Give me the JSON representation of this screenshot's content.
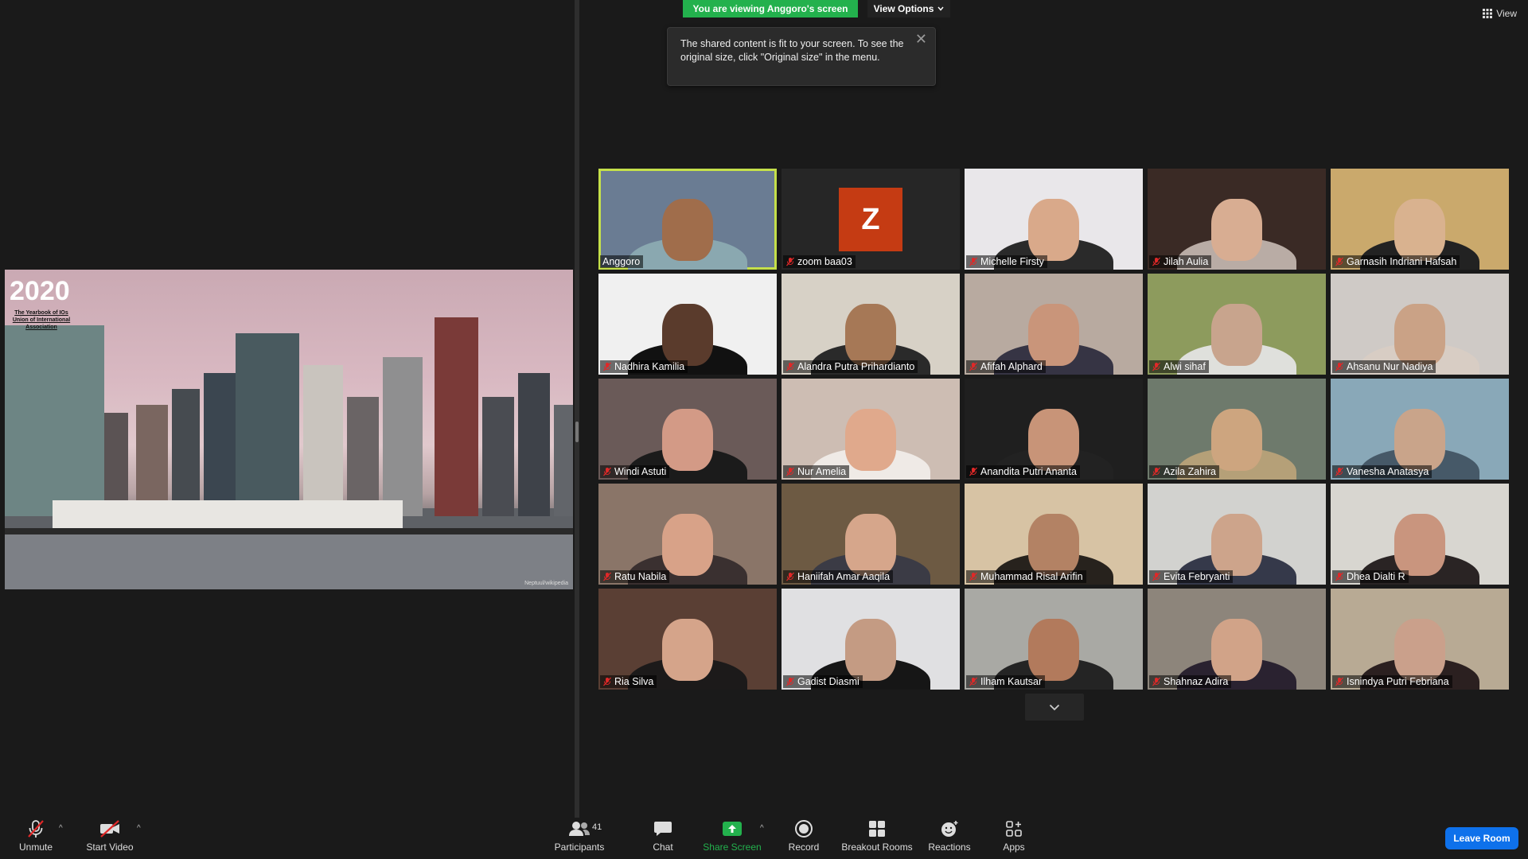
{
  "banner": {
    "viewing": "You are viewing Anggoro's screen",
    "view_options": "View Options"
  },
  "tooltip": {
    "text": "The shared content is fit to your screen. To see the original size, click \"Original size\" in the menu."
  },
  "view_button": {
    "label": "View"
  },
  "slide": {
    "year": "2020",
    "subtitle": "The Yearbook of IOs Union of International Association",
    "credit": "Neptuul/wikipedia"
  },
  "participants": [
    {
      "name": "Anggoro",
      "muted": false,
      "bg": "#6a7c93",
      "skin": "#a06d4b",
      "shirt": "#8aa8b0",
      "active": true
    },
    {
      "name": "zoom baa03",
      "muted": true,
      "avatar": "Z"
    },
    {
      "name": "Michelle Firsty",
      "muted": true,
      "bg": "#e9e7ea",
      "skin": "#d9a98a",
      "shirt": "#2a2a2a"
    },
    {
      "name": "Jilah Aulia",
      "muted": true,
      "bg": "#3a2a25",
      "skin": "#d8ad92",
      "shirt": "#b9aca5"
    },
    {
      "name": "Garnasih Indriani Hafsah",
      "muted": true,
      "bg": "#caa96c",
      "skin": "#d9b28f",
      "shirt": "#222"
    },
    {
      "name": "Nadhira Kamilia",
      "muted": true,
      "bg": "#f0f0f0",
      "skin": "#5a3b2c",
      "shirt": "#111"
    },
    {
      "name": "Alandra Putra Prihardianto",
      "muted": true,
      "bg": "#d7d1c6",
      "skin": "#a67856",
      "shirt": "#2a2a2a"
    },
    {
      "name": "Afifah Alphard",
      "muted": true,
      "bg": "#b8aaa0",
      "skin": "#c9957a",
      "shirt": "#363444"
    },
    {
      "name": "Alwi sihaf",
      "muted": true,
      "bg": "#8d9b5d",
      "skin": "#c8a48d",
      "shirt": "#dfe0dc"
    },
    {
      "name": "Ahsanu Nur Nadiya",
      "muted": true,
      "bg": "#cfcac6",
      "skin": "#caa286",
      "shirt": "#d8cdc4"
    },
    {
      "name": "Windi Astuti",
      "muted": true,
      "bg": "#6a5a58",
      "skin": "#d39a86",
      "shirt": "#1b1b1b"
    },
    {
      "name": "Nur Amelia",
      "muted": true,
      "bg": "#cdbdb3",
      "skin": "#e0a98c",
      "shirt": "#efeae6"
    },
    {
      "name": "Anandita Putri Ananta",
      "muted": true,
      "bg": "#1f1f1f",
      "skin": "#c89478",
      "shirt": "#222"
    },
    {
      "name": "Azila Zahira",
      "muted": true,
      "bg": "#6e7a6c",
      "skin": "#cda57f",
      "shirt": "#b5a078"
    },
    {
      "name": "Vanesha Anatasya",
      "muted": true,
      "bg": "#89a8b8",
      "skin": "#c9a48a",
      "shirt": "#465968"
    },
    {
      "name": "Ratu Nabila",
      "muted": true,
      "bg": "#8a7568",
      "skin": "#d8a288",
      "shirt": "#3a3030"
    },
    {
      "name": "Haniifah Amar Aaqila",
      "muted": true,
      "bg": "#6d5a43",
      "skin": "#d6a68b",
      "shirt": "#3b3b45"
    },
    {
      "name": "Muhammad Risal Arifin",
      "muted": true,
      "bg": "#d7c3a4",
      "skin": "#b38264",
      "shirt": "#27221d"
    },
    {
      "name": "Evita Febryanti",
      "muted": true,
      "bg": "#d2d2cf",
      "skin": "#cda48b",
      "shirt": "#35394a"
    },
    {
      "name": "Dhea Dialti R",
      "muted": true,
      "bg": "#d8d6d0",
      "skin": "#c9957e",
      "shirt": "#2a2424"
    },
    {
      "name": "Ria Silva",
      "muted": true,
      "bg": "#5a3f34",
      "skin": "#d5a48a",
      "shirt": "#1c1a1a"
    },
    {
      "name": "Gadist Diasmi",
      "muted": true,
      "bg": "#e0e0e2",
      "skin": "#c49b83",
      "shirt": "#161616"
    },
    {
      "name": "Ilham Kautsar",
      "muted": true,
      "bg": "#a9a9a4",
      "skin": "#b27a5c",
      "shirt": "#242424"
    },
    {
      "name": "Shahnaz Adira",
      "muted": true,
      "bg": "#8d857b",
      "skin": "#d1a388",
      "shirt": "#2a2230"
    },
    {
      "name": "Isnindya Putri Febriana",
      "muted": true,
      "bg": "#b8aa94",
      "skin": "#caa08b",
      "shirt": "#2b2020"
    }
  ],
  "toolbar": {
    "unmute": "Unmute",
    "start_video": "Start Video",
    "participants": "Participants",
    "participant_count": "41",
    "chat": "Chat",
    "share_screen": "Share Screen",
    "record": "Record",
    "breakout_rooms": "Breakout Rooms",
    "reactions": "Reactions",
    "apps": "Apps",
    "leave": "Leave Room"
  },
  "colors": {
    "background": "#1a1a1a",
    "share_green": "#23b14d",
    "active_speaker": "#c5e04a",
    "leave_blue": "#0e71eb",
    "muted_red": "#e02828",
    "avatar_orange": "#c53b13"
  }
}
